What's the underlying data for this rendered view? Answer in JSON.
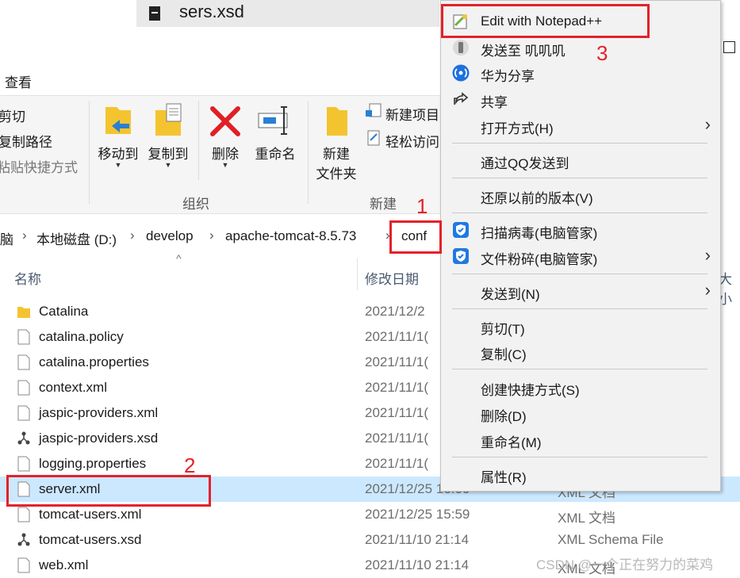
{
  "background_tab": {
    "title": "sers.xsd"
  },
  "ribbon": {
    "tab_view": "查看",
    "clipboard_items": [
      "剪切",
      "复制路径",
      "粘贴快捷方式"
    ],
    "move_to": "移动到",
    "copy_to": "复制到",
    "delete": "删除",
    "rename": "重命名",
    "group_organize": "组织",
    "new_folder_line1": "新建",
    "new_folder_line2": "文件夹",
    "new_item": "新建项目",
    "easy_access": "轻松访问",
    "group_new": "新建"
  },
  "address": {
    "crumbs": [
      "脑",
      "本地磁盘 (D:)",
      "develop",
      "apache-tomcat-8.5.73",
      "conf"
    ]
  },
  "columns": {
    "name": "名称",
    "date": "修改日期",
    "size": "大小"
  },
  "files": [
    {
      "name": "Catalina",
      "date": "2021/12/2",
      "type": "",
      "icon": "folder-icon"
    },
    {
      "name": "catalina.policy",
      "date": "2021/11/1(",
      "type": "",
      "icon": "file-icon"
    },
    {
      "name": "catalina.properties",
      "date": "2021/11/1(",
      "type": "",
      "icon": "file-icon"
    },
    {
      "name": "context.xml",
      "date": "2021/11/1(",
      "type": "",
      "icon": "file-icon"
    },
    {
      "name": "jaspic-providers.xml",
      "date": "2021/11/1(",
      "type": "",
      "icon": "file-icon"
    },
    {
      "name": "jaspic-providers.xsd",
      "date": "2021/11/1(",
      "type": "",
      "icon": "schema-icon"
    },
    {
      "name": "logging.properties",
      "date": "2021/11/1(",
      "type": "",
      "icon": "file-icon"
    },
    {
      "name": "server.xml",
      "date": "2021/12/25 16:00",
      "type": "XML 文档",
      "icon": "file-icon",
      "selected": true
    },
    {
      "name": "tomcat-users.xml",
      "date": "2021/12/25 15:59",
      "type": "XML 文档",
      "icon": "file-icon"
    },
    {
      "name": "tomcat-users.xsd",
      "date": "2021/11/10 21:14",
      "type": "XML Schema File",
      "icon": "schema-icon"
    },
    {
      "name": "web.xml",
      "date": "2021/11/10 21:14",
      "type": "XML 文档",
      "icon": "file-icon"
    }
  ],
  "context_menu": {
    "items": [
      {
        "label": "Edit with Notepad++",
        "icon": "notepadpp-icon"
      },
      {
        "label": "发送至 叽叽叽",
        "icon": "phone-icon"
      },
      {
        "label": "华为分享",
        "icon": "huawei-share-icon"
      },
      {
        "label": "共享",
        "icon": "share-icon"
      },
      {
        "label": "打开方式(H)",
        "submenu": true
      },
      {
        "label": "通过QQ发送到"
      },
      {
        "label": "还原以前的版本(V)"
      },
      {
        "label": "扫描病毒(电脑管家)",
        "icon": "shield-icon"
      },
      {
        "label": "文件粉碎(电脑管家)",
        "icon": "shield-icon",
        "submenu": true
      },
      {
        "label": "发送到(N)",
        "submenu": true
      },
      {
        "label": "剪切(T)"
      },
      {
        "label": "复制(C)"
      },
      {
        "label": "创建快捷方式(S)"
      },
      {
        "label": "删除(D)"
      },
      {
        "label": "重命名(M)"
      },
      {
        "label": "属性(R)"
      }
    ]
  },
  "annotations": {
    "step1": "1",
    "step2": "2",
    "step3": "3"
  },
  "watermark": "CSDN @一个正在努力的菜鸡",
  "colors": {
    "selection": "#cce8ff",
    "annotation_red": "#e3222a",
    "menu_bg": "#f2f2f2"
  }
}
